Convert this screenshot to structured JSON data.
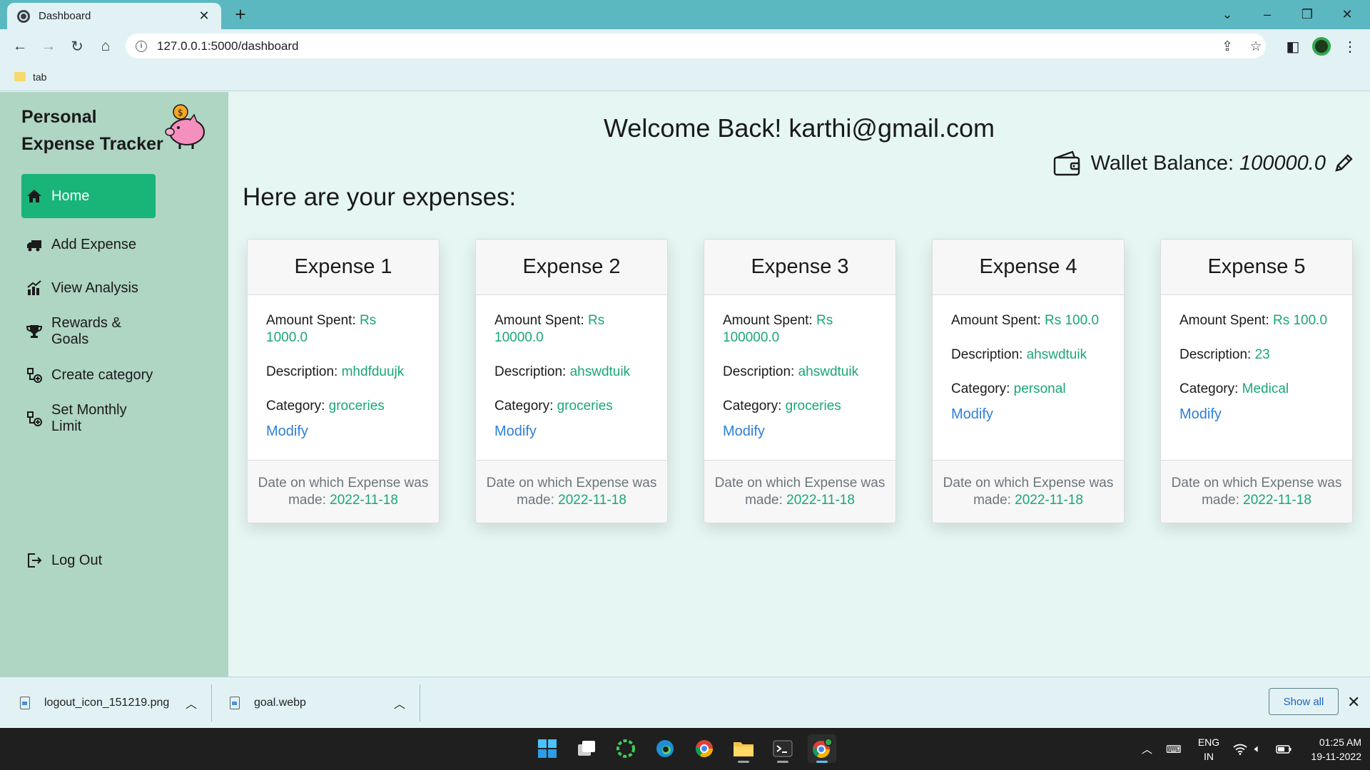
{
  "browser": {
    "tab_title": "Dashboard",
    "url": "127.0.0.1:5000/dashboard",
    "bookmark_folder": "tab",
    "new_tab_symbol": "+",
    "close_symbol": "✕"
  },
  "sidebar": {
    "brand_line1": "Personal",
    "brand_line2": "Expense Tracker",
    "items": [
      {
        "label": "Home",
        "icon": "home-icon",
        "active": true
      },
      {
        "label": "Add Expense",
        "icon": "truck-icon"
      },
      {
        "label": "View Analysis",
        "icon": "chart-icon"
      },
      {
        "label": "Rewards & Goals",
        "icon": "trophy-icon"
      },
      {
        "label": "Create category",
        "icon": "category-icon"
      },
      {
        "label": "Set Monthly Limit",
        "icon": "limit-icon"
      }
    ],
    "logout_label": "Log Out"
  },
  "main": {
    "welcome": "Welcome Back! karthi@gmail.com",
    "wallet_label": "Wallet Balance:",
    "wallet_amount": "100000.0",
    "subheading": "Here are your expenses:",
    "labels": {
      "amount": "Amount Spent:",
      "description": "Description:",
      "category": "Category:",
      "modify": "Modify",
      "date_prefix": "Date on which Expense was made:"
    },
    "cards": [
      {
        "title": "Expense 1",
        "amount": "Rs 1000.0",
        "description": "mhdfduujk",
        "category": "groceries",
        "date": "2022-11-18"
      },
      {
        "title": "Expense 2",
        "amount": "Rs 10000.0",
        "description": "ahswdtuik",
        "category": "groceries",
        "date": "2022-11-18"
      },
      {
        "title": "Expense 3",
        "amount": "Rs 100000.0",
        "description": "ahswdtuik",
        "category": "groceries",
        "date": "2022-11-18"
      },
      {
        "title": "Expense 4",
        "amount": "Rs 100.0",
        "description": "ahswdtuik",
        "category": "personal",
        "date": "2022-11-18"
      },
      {
        "title": "Expense 5",
        "amount": "Rs 100.0",
        "description": "23",
        "category": "Medical",
        "date": "2022-11-18"
      }
    ]
  },
  "downloads": {
    "items": [
      {
        "name": "logout_icon_151219.png"
      },
      {
        "name": "goal.webp"
      }
    ],
    "show_all": "Show all"
  },
  "taskbar": {
    "lang_line1": "ENG",
    "lang_line2": "IN",
    "time": "01:25 AM",
    "date": "19-11-2022"
  },
  "colors": {
    "accent": "#19b578",
    "value_text": "#1aa67a",
    "link": "#2f7fd8",
    "sidebar_bg": "#afd5c3",
    "main_bg": "#e6f6f3",
    "chrome_bg": "#5bb8c1"
  }
}
